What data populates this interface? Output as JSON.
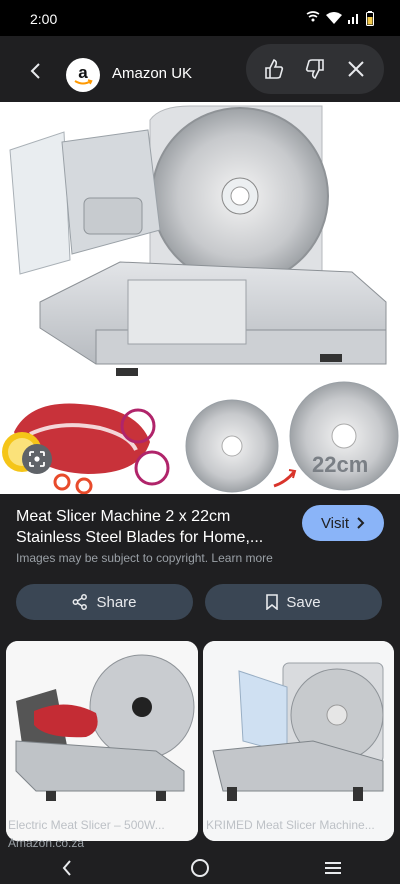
{
  "status_bar": {
    "time": "2:00"
  },
  "header": {
    "source_name": "Amazon UK",
    "logo_letter": "a"
  },
  "result": {
    "title": "Meat Slicer Machine 2 x 22cm Stainless Steel Blades for Home,...",
    "copyright": "Images may be subject to copyright. Learn more",
    "visit_label": "Visit",
    "blade_size_label": "22cm"
  },
  "actions": {
    "share_label": "Share",
    "save_label": "Save"
  },
  "related": [
    {
      "caption": "Electric Meat Slicer – 500W...",
      "source": "Amazon.co.za"
    },
    {
      "caption": "KRIMED Meat Slicer Machine..."
    }
  ],
  "colors": {
    "accent": "#8ab4f8",
    "action_button_bg": "#3a4654",
    "page_bg": "#1f1f21"
  }
}
